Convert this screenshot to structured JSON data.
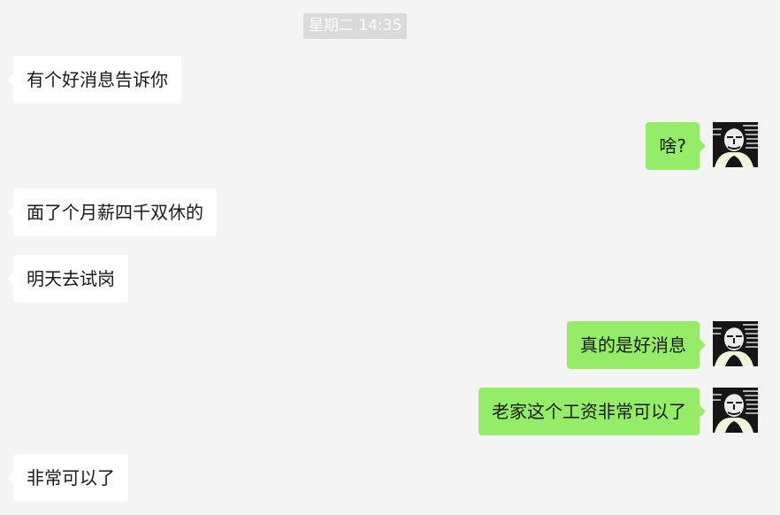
{
  "chat": {
    "timestamp": "星期二 14:35",
    "messages": [
      {
        "sender": "other",
        "text": "有个好消息告诉你"
      },
      {
        "sender": "self",
        "text": "啥?"
      },
      {
        "sender": "other",
        "text": "面了个月薪四千双休的"
      },
      {
        "sender": "other",
        "text": "明天去试岗"
      },
      {
        "sender": "self",
        "text": "真的是好消息"
      },
      {
        "sender": "self",
        "text": "老家这个工资非常可以了"
      },
      {
        "sender": "other",
        "text": "非常可以了"
      }
    ]
  },
  "colors": {
    "background": "#f4f4f4",
    "incoming_bubble": "#ffffff",
    "outgoing_bubble": "#95ec69",
    "timestamp_bg": "#dadada"
  },
  "icons": {
    "avatar": "woodcut-portrait-avatar"
  }
}
